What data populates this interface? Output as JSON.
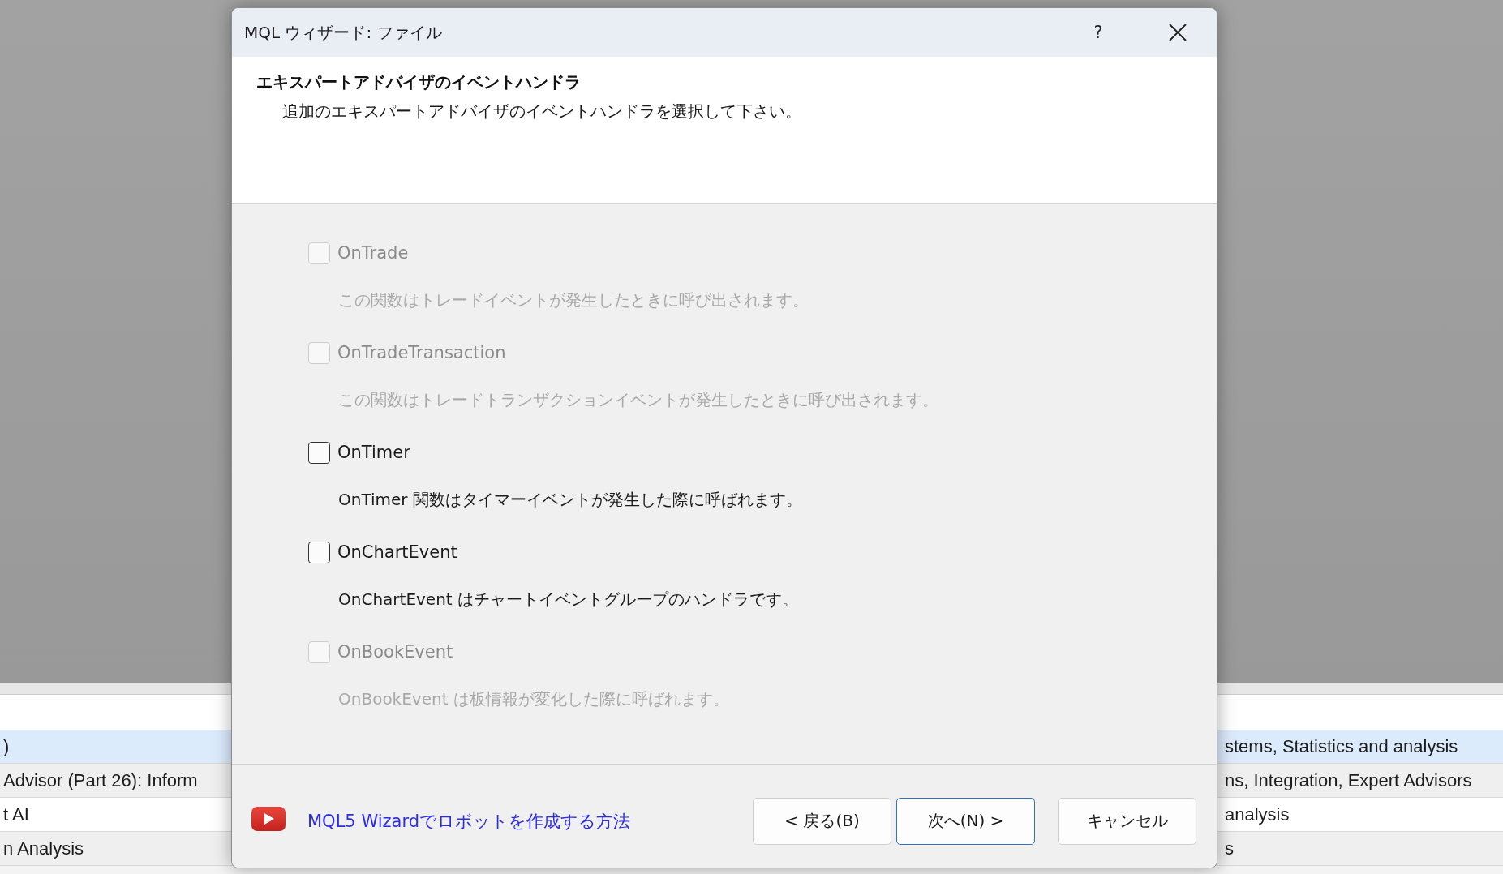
{
  "window": {
    "title": "MQL ウィザード: ファイル",
    "help_button": "?"
  },
  "header": {
    "title": "エキスパートアドバイザのイベントハンドラ",
    "subtitle": "追加のエキスパートアドバイザのイベントハンドラを選択して下さい。"
  },
  "handlers": [
    {
      "label": "OnTrade",
      "description": "この関数はトレードイベントが発生したときに呼び出されます。",
      "checked": false,
      "disabled": true
    },
    {
      "label": "OnTradeTransaction",
      "description": "この関数はトレードトランザクションイベントが発生したときに呼び出されます。",
      "checked": false,
      "disabled": true
    },
    {
      "label": "OnTimer",
      "description": "OnTimer 関数はタイマーイベントが発生した際に呼ばれます。",
      "checked": false,
      "disabled": false
    },
    {
      "label": "OnChartEvent",
      "description": "OnChartEvent はチャートイベントグループのハンドラです。",
      "checked": false,
      "disabled": false
    },
    {
      "label": "OnBookEvent",
      "description": "OnBookEvent は板情報が変化した際に呼ばれます。",
      "checked": false,
      "disabled": true
    }
  ],
  "footer": {
    "link": "MQL5 Wizardでロボットを作成する方法",
    "buttons": [
      {
        "label": "< 戻る(B)",
        "default": false
      },
      {
        "label": "次へ(N) >",
        "default": true
      },
      {
        "label": "キャンセル",
        "default": false
      }
    ]
  },
  "background_list": {
    "rows": [
      {
        "left": ")",
        "right": "stems, Statistics and analysis",
        "selected": true
      },
      {
        "left": "Advisor (Part 26): Inform",
        "right": "ns, Integration, Expert Advisors",
        "selected": false
      },
      {
        "left": "t AI",
        "right": "analysis",
        "selected": false
      },
      {
        "left": "n Analysis",
        "right": "s",
        "selected": false
      }
    ]
  }
}
